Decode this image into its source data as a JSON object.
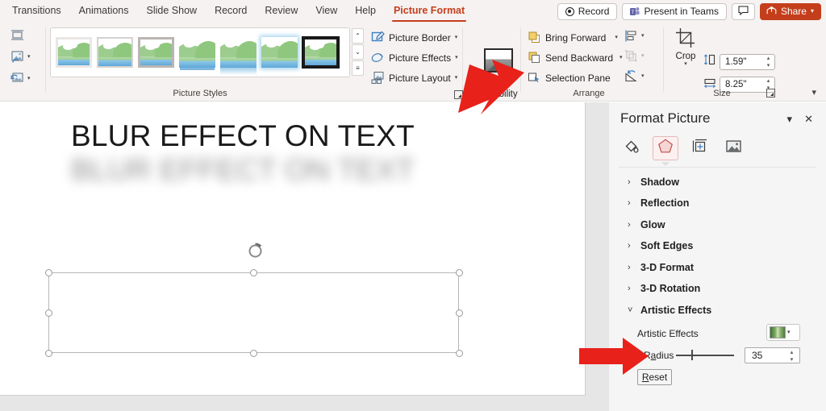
{
  "app": {
    "ribbon_tabs": [
      {
        "label": "Transitions",
        "active": false
      },
      {
        "label": "Animations",
        "active": false
      },
      {
        "label": "Slide Show",
        "active": false
      },
      {
        "label": "Record",
        "active": false
      },
      {
        "label": "Review",
        "active": false
      },
      {
        "label": "View",
        "active": false
      },
      {
        "label": "Help",
        "active": false
      },
      {
        "label": "Picture Format",
        "active": true
      }
    ],
    "title_actions": {
      "record_label": "Record",
      "present_in_teams_label": "Present in Teams",
      "comments_icon": "comment-icon",
      "share_label": "Share",
      "share_color": "#c43e1c"
    }
  },
  "ribbon": {
    "adjust_icons": [
      {
        "name": "compress-pictures-icon"
      },
      {
        "name": "change-picture-icon"
      },
      {
        "name": "reset-picture-icon"
      }
    ],
    "picture_styles": {
      "group_label": "Picture Styles",
      "thumbnails": [
        {
          "name": "simple-frame-white",
          "selected": false
        },
        {
          "name": "beveled-matte-white",
          "selected": false
        },
        {
          "name": "metal-frame",
          "selected": false
        },
        {
          "name": "drop-shadow-rectangle",
          "selected": false
        },
        {
          "name": "reflected-rounded-rectangle",
          "selected": false
        },
        {
          "name": "soft-edge-oval",
          "selected": false
        },
        {
          "name": "thick-matte-black",
          "selected": true
        }
      ],
      "scroll_up": "⌃",
      "scroll_down": "⌄",
      "more": "⌄"
    },
    "commands": [
      {
        "label": "Picture Border",
        "icon": "picture-border-icon",
        "has_menu": true
      },
      {
        "label": "Picture Effects",
        "icon": "picture-effects-icon",
        "has_menu": true
      },
      {
        "label": "Picture Layout",
        "icon": "picture-layout-icon",
        "has_menu": true
      }
    ],
    "accessibility": {
      "label": "Accessibility",
      "alt_text_icon": "alt-text-picture-icon",
      "dialog_launcher": "dialog-launcher-icon"
    },
    "arrange": {
      "group_label": "Arrange",
      "items": [
        {
          "label": "Bring Forward",
          "icon": "bring-forward-icon",
          "has_menu": true,
          "disabled": false
        },
        {
          "label": "Send Backward",
          "icon": "send-backward-icon",
          "has_menu": true,
          "disabled": false
        },
        {
          "label": "Selection Pane",
          "icon": "selection-pane-icon",
          "has_menu": false,
          "disabled": false
        }
      ],
      "tools": [
        {
          "name": "align-objects-icon",
          "disabled": false
        },
        {
          "name": "group-objects-icon",
          "disabled": true
        },
        {
          "name": "rotate-objects-icon",
          "disabled": false
        }
      ]
    },
    "size": {
      "group_label": "Size",
      "crop_label": "Crop",
      "crop_icon": "crop-icon",
      "height_icon": "shape-height-icon",
      "height_value": "1.59\"",
      "width_icon": "shape-width-icon",
      "width_value": "8.25\"",
      "dialog_launcher": "dialog-launcher-icon",
      "spin_up": "⌃",
      "spin_down": "⌄"
    },
    "collapse_ribbon": "⌄"
  },
  "slide": {
    "sharp_text": "BLUR EFFECT ON TEXT",
    "blurred_text": "BLUR EFFECT ON TEXT",
    "rotate_handle": "rotate-handle-icon",
    "selection_handles": 8
  },
  "pane": {
    "title": "Format Picture",
    "collapse_icon": "chevron-down-icon",
    "close_icon": "close-icon",
    "tabs": [
      {
        "name": "fill-and-line-icon",
        "selected": false
      },
      {
        "name": "effects-icon",
        "selected": true
      },
      {
        "name": "size-and-properties-icon",
        "selected": false
      },
      {
        "name": "picture-icon",
        "selected": false
      }
    ],
    "sections": [
      {
        "label": "Shadow",
        "expanded": false
      },
      {
        "label": "Reflection",
        "expanded": false
      },
      {
        "label": "Glow",
        "expanded": false
      },
      {
        "label": "Soft Edges",
        "expanded": false
      },
      {
        "label": "3-D Format",
        "expanded": false
      },
      {
        "label": "3-D Rotation",
        "expanded": false
      },
      {
        "label": "Artistic Effects",
        "expanded": true
      }
    ],
    "caret_collapsed": "›",
    "caret_expanded": "˅",
    "artistic_effects": {
      "label": "Artistic Effects",
      "gallery_icon": "artistic-effect-preview",
      "gallery_chevron": "⌄",
      "radius_label_pre": "R",
      "radius_label_accel": "a",
      "radius_label_post": "dius",
      "radius_value": "35",
      "spin_up": "⌃",
      "spin_down": "⌄",
      "reset_accel": "R",
      "reset_rest": "eset"
    }
  },
  "callouts": {
    "arrow_color": "#e8211a",
    "arrows": [
      {
        "name": "callout-arrow-accessibility",
        "points_to": "Accessibility"
      },
      {
        "name": "callout-arrow-radius",
        "points_to": "Radius"
      }
    ]
  }
}
